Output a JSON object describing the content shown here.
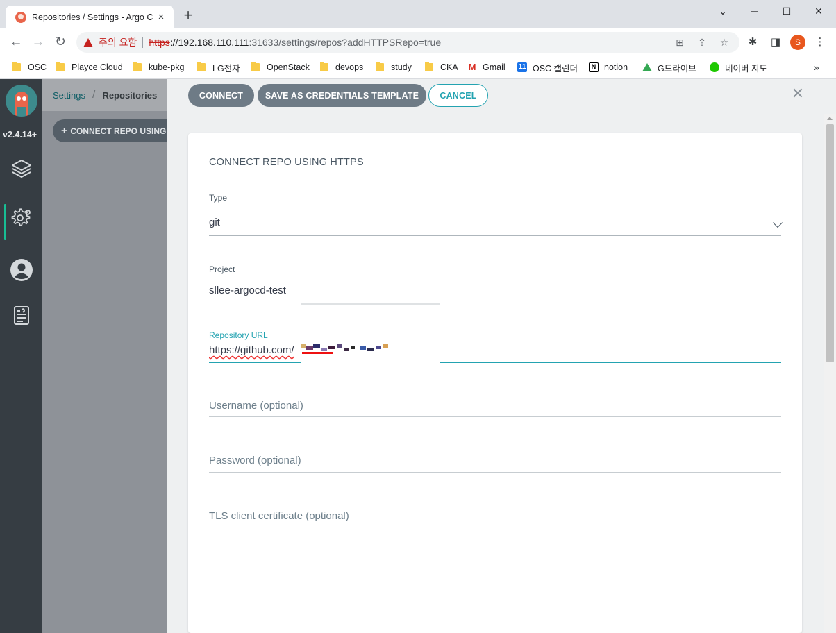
{
  "browser": {
    "tab_title": "Repositories / Settings - Argo C",
    "window_controls": {
      "minimize": "─",
      "maximize": "☐",
      "close": "✕"
    },
    "security_warning": "주의 요함",
    "url": {
      "scheme": "https",
      "host": "://192.168.110.111",
      "rest": ":31633/settings/repos?addHTTPSRepo=true"
    },
    "profile_initial": "S",
    "bookmarks": [
      {
        "label": "OSC",
        "icon": "folder-icon"
      },
      {
        "label": "Playce Cloud",
        "icon": "folder-icon"
      },
      {
        "label": "kube-pkg",
        "icon": "folder-icon"
      },
      {
        "label": "LG전자",
        "icon": "folder-icon"
      },
      {
        "label": "OpenStack",
        "icon": "folder-icon"
      },
      {
        "label": "devops",
        "icon": "folder-icon"
      },
      {
        "label": "study",
        "icon": "folder-icon"
      },
      {
        "label": "CKA",
        "icon": "folder-icon"
      },
      {
        "label": "Gmail",
        "icon": "gmail-icon"
      },
      {
        "label": "OSC 캘린더",
        "icon": "calendar-icon"
      },
      {
        "label": "notion",
        "icon": "notion-icon"
      },
      {
        "label": "G드라이브",
        "icon": "drive-icon"
      },
      {
        "label": "네이버 지도",
        "icon": "naver-map-icon"
      }
    ],
    "bookmarks_more": "»"
  },
  "app": {
    "version": "v2.4.14+",
    "breadcrumb": {
      "parent": "Settings",
      "current": "Repositories"
    },
    "connect_repo_button": "CONNECT REPO USING",
    "nav_icons": [
      "layers-icon",
      "gear-icon",
      "user-icon",
      "docs-icon"
    ]
  },
  "panel": {
    "buttons": {
      "connect": "CONNECT",
      "save_template": "SAVE AS CREDENTIALS TEMPLATE",
      "cancel": "CANCEL"
    },
    "title": "CONNECT REPO USING HTTPS",
    "fields": {
      "type": {
        "label": "Type",
        "value": "git"
      },
      "project": {
        "label": "Project",
        "value": "sllee-argocd-test"
      },
      "repo_url": {
        "label": "Repository URL",
        "value": "https://github.com/"
      },
      "username": {
        "placeholder": "Username (optional)"
      },
      "password": {
        "placeholder": "Password (optional)"
      },
      "tls_cert": {
        "placeholder": "TLS client certificate (optional)"
      }
    }
  },
  "colors": {
    "accent": "#23a3b1",
    "nav_bg": "#363d43",
    "button_dark": "#6e7b86",
    "warning": "#c5221f"
  }
}
